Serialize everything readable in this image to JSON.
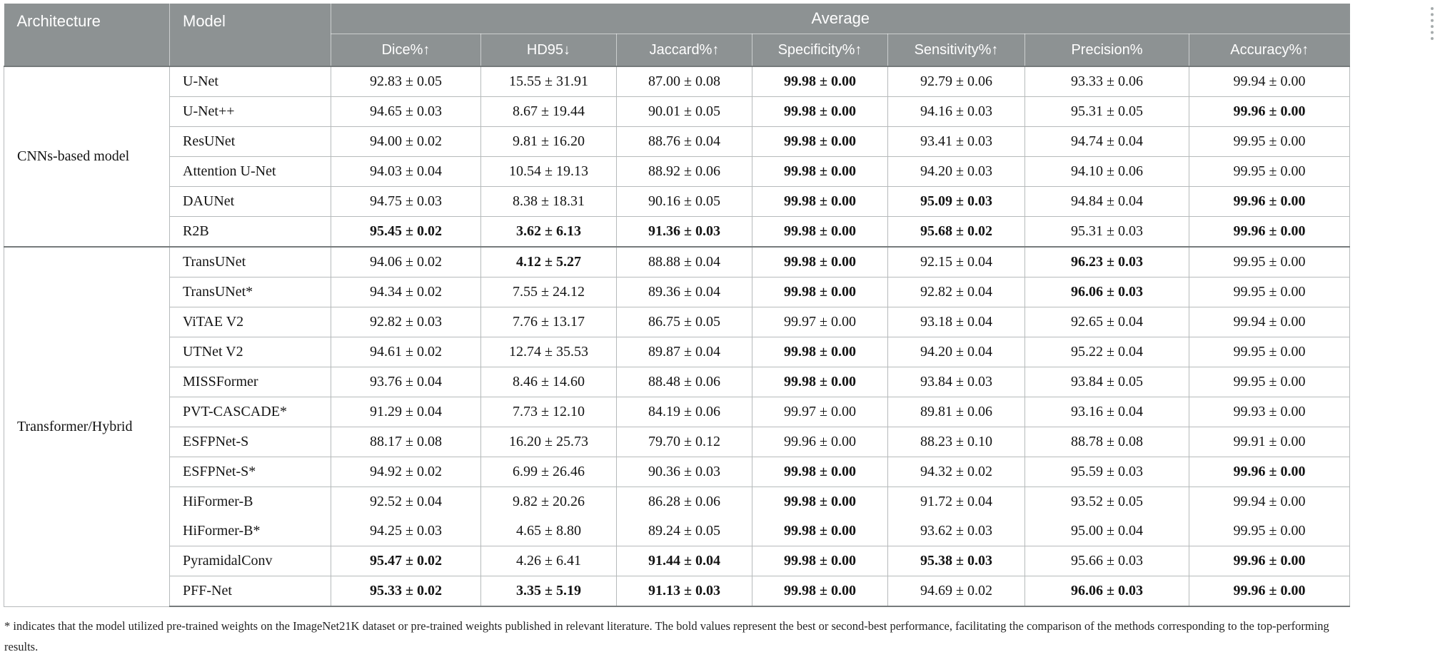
{
  "colors": {
    "header_bg": "#8d9293",
    "header_text": "#ffffff",
    "header_separator": "rgba(255,255,255,0.55)",
    "grid_border_light": "#b6babb",
    "grid_border_dark": "#767b7c",
    "cell_text": "#141414",
    "footnote_text": "#242424",
    "row_bg": "#ffffff"
  },
  "table": {
    "headers": {
      "architecture": "Architecture",
      "model": "Model",
      "group": "Average",
      "metrics": [
        "Dice%↑",
        "HD95↓",
        "Jaccard%↑",
        "Specificity%↑",
        "Sensitivity%↑",
        "Precision%",
        "Accuracy%↑"
      ]
    },
    "sections": [
      {
        "architecture": "CNNs-based model",
        "rows": [
          {
            "model": "U-Net",
            "values": [
              "92.83 ± 0.05",
              "15.55 ± 31.91",
              "87.00 ± 0.08",
              "99.98 ± 0.00",
              "92.79 ± 0.06",
              "93.33 ± 0.06",
              "99.94 ± 0.00"
            ],
            "bold": [
              false,
              false,
              false,
              true,
              false,
              false,
              false
            ]
          },
          {
            "model": "U-Net++",
            "values": [
              "94.65 ± 0.03",
              "8.67 ± 19.44",
              "90.01 ± 0.05",
              "99.98 ± 0.00",
              "94.16 ± 0.03",
              "95.31 ± 0.05",
              "99.96 ± 0.00"
            ],
            "bold": [
              false,
              false,
              false,
              true,
              false,
              false,
              true
            ]
          },
          {
            "model": "ResUNet",
            "values": [
              "94.00 ± 0.02",
              "9.81 ± 16.20",
              "88.76 ± 0.04",
              "99.98 ± 0.00",
              "93.41 ± 0.03",
              "94.74 ± 0.04",
              "99.95 ± 0.00"
            ],
            "bold": [
              false,
              false,
              false,
              true,
              false,
              false,
              false
            ]
          },
          {
            "model": "Attention U-Net",
            "values": [
              "94.03 ± 0.04",
              "10.54 ± 19.13",
              "88.92 ± 0.06",
              "99.98 ± 0.00",
              "94.20 ± 0.03",
              "94.10 ± 0.06",
              "99.95 ± 0.00"
            ],
            "bold": [
              false,
              false,
              false,
              true,
              false,
              false,
              false
            ]
          },
          {
            "model": "DAUNet",
            "values": [
              "94.75 ± 0.03",
              "8.38 ± 18.31",
              "90.16 ± 0.05",
              "99.98 ± 0.00",
              "95.09 ± 0.03",
              "94.84 ± 0.04",
              "99.96 ± 0.00"
            ],
            "bold": [
              false,
              false,
              false,
              true,
              true,
              false,
              true
            ]
          },
          {
            "model": "R2B",
            "values": [
              "95.45 ± 0.02",
              "3.62 ± 6.13",
              "91.36 ± 0.03",
              "99.98 ± 0.00",
              "95.68 ± 0.02",
              "95.31 ± 0.03",
              "99.96 ± 0.00"
            ],
            "bold": [
              true,
              true,
              true,
              true,
              true,
              false,
              true
            ]
          }
        ]
      },
      {
        "architecture": "Transformer/Hybrid",
        "rows": [
          {
            "model": "TransUNet",
            "values": [
              "94.06 ± 0.02",
              "4.12 ± 5.27",
              "88.88 ± 0.04",
              "99.98 ± 0.00",
              "92.15 ± 0.04",
              "96.23 ± 0.03",
              "99.95 ± 0.00"
            ],
            "bold": [
              false,
              true,
              false,
              true,
              false,
              true,
              false
            ]
          },
          {
            "model": "TransUNet*",
            "values": [
              "94.34 ± 0.02",
              "7.55 ± 24.12",
              "89.36 ± 0.04",
              "99.98 ± 0.00",
              "92.82 ± 0.04",
              "96.06 ± 0.03",
              "99.95 ± 0.00"
            ],
            "bold": [
              false,
              false,
              false,
              true,
              false,
              true,
              false
            ]
          },
          {
            "model": "ViTAE V2",
            "values": [
              "92.82 ± 0.03",
              "7.76 ± 13.17",
              "86.75 ± 0.05",
              "99.97 ± 0.00",
              "93.18 ± 0.04",
              "92.65 ± 0.04",
              "99.94 ± 0.00"
            ],
            "bold": [
              false,
              false,
              false,
              false,
              false,
              false,
              false
            ]
          },
          {
            "model": "UTNet V2",
            "values": [
              "94.61 ± 0.02",
              "12.74 ± 35.53",
              "89.87 ± 0.04",
              "99.98 ± 0.00",
              "94.20 ± 0.04",
              "95.22 ± 0.04",
              "99.95 ± 0.00"
            ],
            "bold": [
              false,
              false,
              false,
              true,
              false,
              false,
              false
            ]
          },
          {
            "model": "MISSFormer",
            "values": [
              "93.76 ± 0.04",
              "8.46 ± 14.60",
              "88.48 ± 0.06",
              "99.98 ± 0.00",
              "93.84 ± 0.03",
              "93.84 ± 0.05",
              "99.95 ± 0.00"
            ],
            "bold": [
              false,
              false,
              false,
              true,
              false,
              false,
              false
            ]
          },
          {
            "model": "PVT-CASCADE*",
            "values": [
              "91.29 ± 0.04",
              "7.73 ± 12.10",
              "84.19 ± 0.06",
              "99.97 ± 0.00",
              "89.81 ± 0.06",
              "93.16 ± 0.04",
              "99.93 ± 0.00"
            ],
            "bold": [
              false,
              false,
              false,
              false,
              false,
              false,
              false
            ]
          },
          {
            "model": "ESFPNet-S",
            "values": [
              "88.17 ± 0.08",
              "16.20 ± 25.73",
              "79.70 ± 0.12",
              "99.96 ± 0.00",
              "88.23 ± 0.10",
              "88.78 ± 0.08",
              "99.91 ± 0.00"
            ],
            "bold": [
              false,
              false,
              false,
              false,
              false,
              false,
              false
            ]
          },
          {
            "model": "ESFPNet-S*",
            "values": [
              "94.92 ± 0.02",
              "6.99 ± 26.46",
              "90.36 ± 0.03",
              "99.98 ± 0.00",
              "94.32 ± 0.02",
              "95.59 ± 0.03",
              "99.96 ± 0.00"
            ],
            "bold": [
              false,
              false,
              false,
              true,
              false,
              false,
              true
            ]
          },
          {
            "model": "HiFormer-B",
            "values": [
              "92.52 ± 0.04",
              "9.82 ± 20.26",
              "86.28 ± 0.06",
              "99.98 ± 0.00",
              "91.72 ± 0.04",
              "93.52 ± 0.05",
              "99.94 ± 0.00"
            ],
            "bold": [
              false,
              false,
              false,
              true,
              false,
              false,
              false
            ],
            "divider_below": false
          },
          {
            "model": "HiFormer-B*",
            "values": [
              "94.25 ± 0.03",
              "4.65 ± 8.80",
              "89.24 ± 0.05",
              "99.98 ± 0.00",
              "93.62 ± 0.03",
              "95.00 ± 0.04",
              "99.95 ± 0.00"
            ],
            "bold": [
              false,
              false,
              false,
              true,
              false,
              false,
              false
            ]
          },
          {
            "model": "PyramidalConv",
            "values": [
              "95.47 ± 0.02",
              "4.26 ± 6.41",
              "91.44 ± 0.04",
              "99.98 ± 0.00",
              "95.38 ± 0.03",
              "95.66 ± 0.03",
              "99.96 ± 0.00"
            ],
            "bold": [
              true,
              false,
              true,
              true,
              true,
              false,
              true
            ]
          },
          {
            "model": "PFF-Net",
            "values": [
              "95.33 ± 0.02",
              "3.35 ± 5.19",
              "91.13 ± 0.03",
              "99.98 ± 0.00",
              "94.69 ± 0.02",
              "96.06 ± 0.03",
              "99.96 ± 0.00"
            ],
            "bold": [
              true,
              true,
              true,
              true,
              false,
              true,
              true
            ]
          }
        ]
      }
    ],
    "footnote": "* indicates that the model utilized pre-trained weights on the ImageNet21K dataset or pre-trained weights published in relevant literature. The bold values represent the best or second-best performance, facilitating the comparison of the methods corresponding to the top-performing results."
  }
}
